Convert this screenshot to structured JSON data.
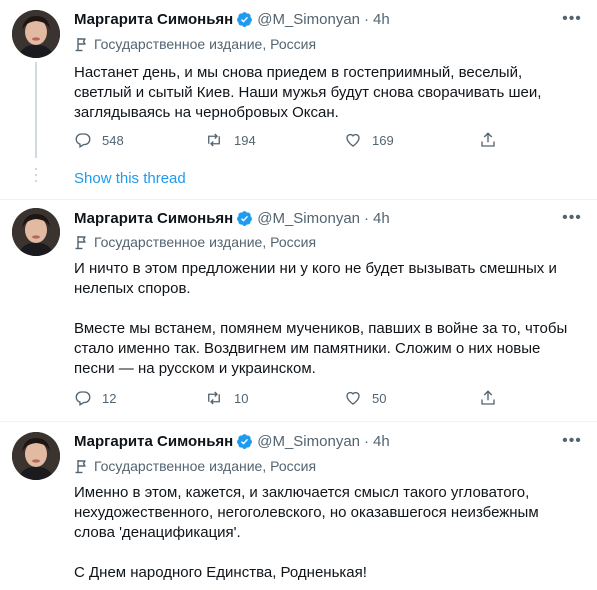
{
  "colors": {
    "link": "#1d9bf0",
    "verified": "#1d9bf0",
    "secondary": "#536471"
  },
  "tweets": [
    {
      "author": "Маргарита Симоньян",
      "handle": "@M_Simonyan",
      "separator": "·",
      "time": "4h",
      "label": "Государственное издание, Россия",
      "paragraphs": [
        "Настанет день, и мы снова приедем в гостеприимный, веселый, светлый и сытый Киев. Наши мужья будут снова сворачивать шеи, заглядываясь на чернобровых Оксан."
      ],
      "replies": "548",
      "retweets": "194",
      "likes": "169"
    },
    {
      "author": "Маргарита Симоньян",
      "handle": "@M_Simonyan",
      "separator": "·",
      "time": "4h",
      "label": "Государственное издание, Россия",
      "paragraphs": [
        "И ничто в этом предложении ни у кого не будет вызывать смешных и нелепых споров.",
        "Вместе мы встанем, помянем мучеников, павших в войне за то, чтобы стало именно так. Воздвигнем им памятники. Сложим о них новые песни — на русском и украинском."
      ],
      "replies": "12",
      "retweets": "10",
      "likes": "50"
    },
    {
      "author": "Маргарита Симоньян",
      "handle": "@M_Simonyan",
      "separator": "·",
      "time": "4h",
      "label": "Государственное издание, Россия",
      "paragraphs": [
        "Именно в этом, кажется, и заключается смысл такого угловатого, нехудожественного, негоголевского, но оказавшегося неизбежным слова 'денацификация'.",
        "С Днем народного Единства, Родненькая!"
      ]
    }
  ],
  "show_thread": "Show this thread"
}
